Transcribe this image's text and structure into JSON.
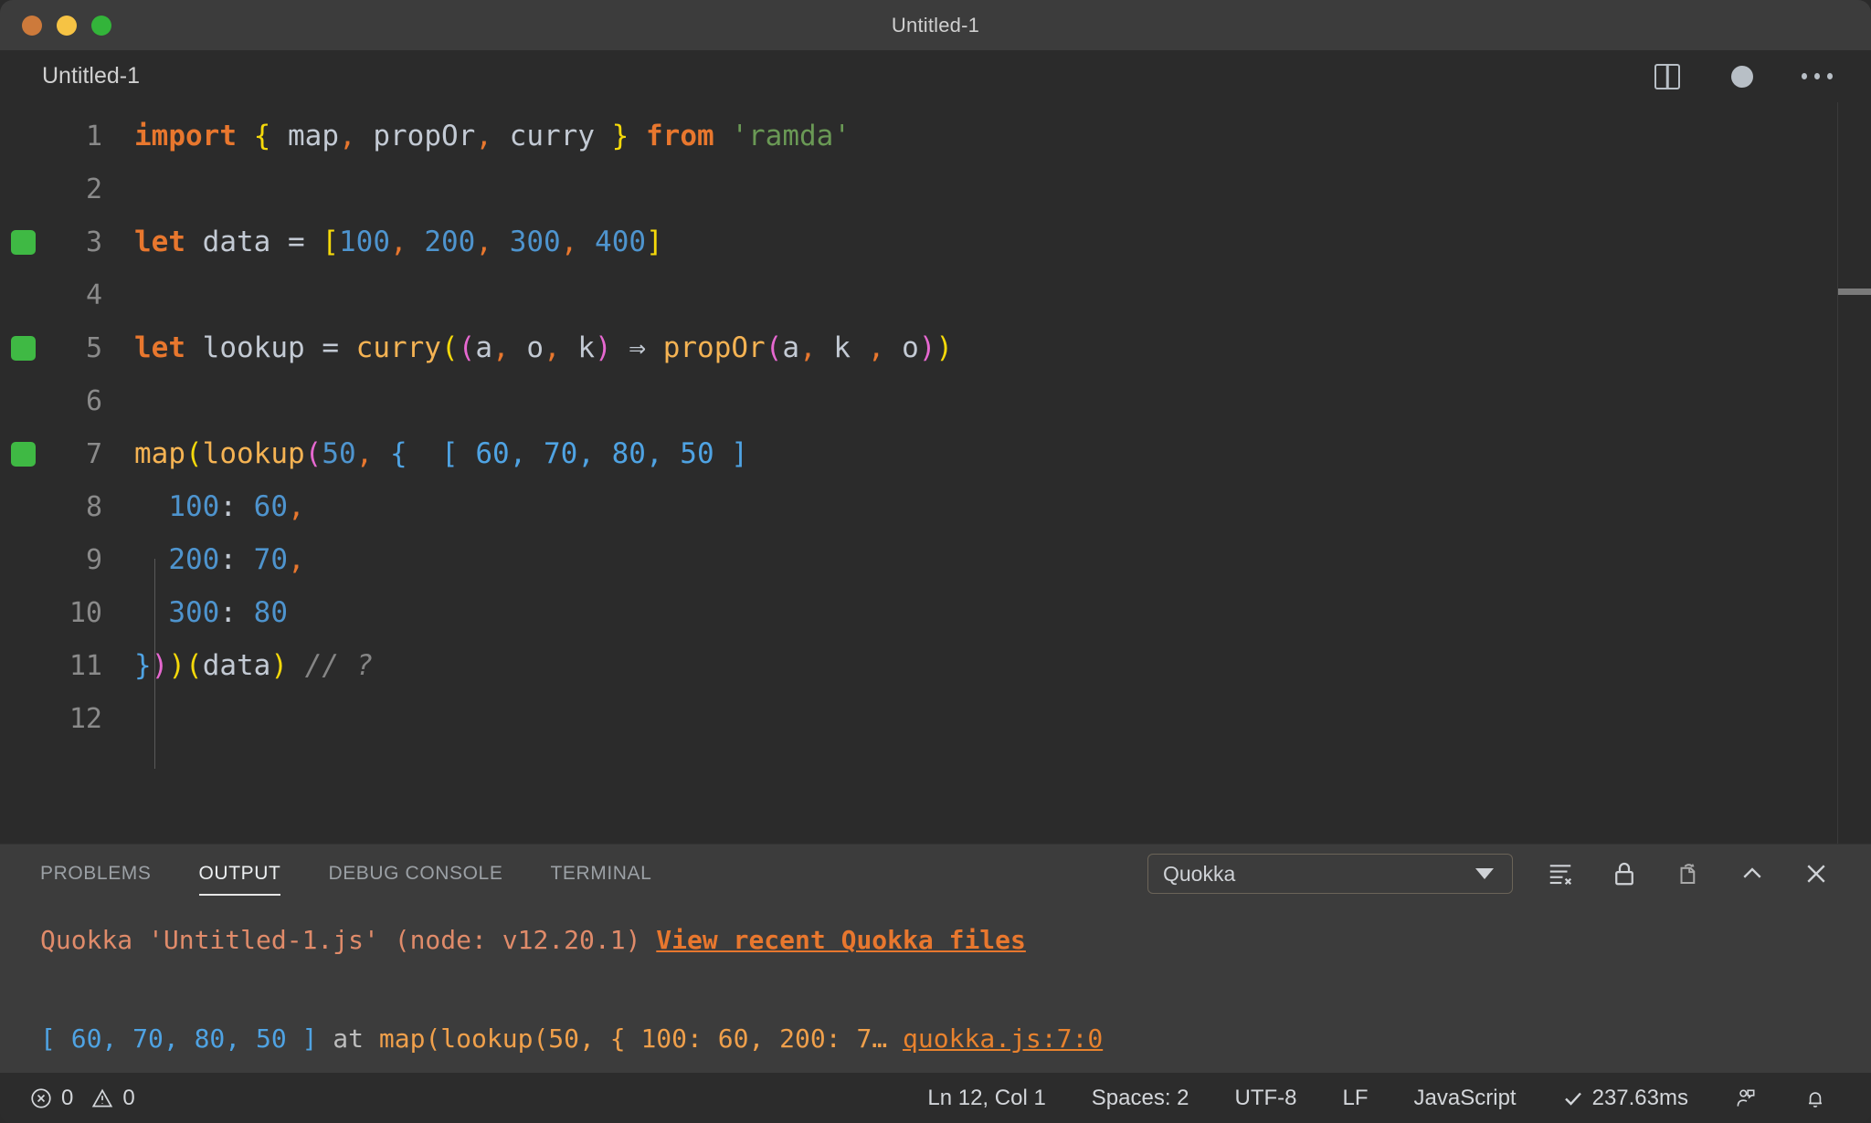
{
  "window": {
    "title": "Untitled-1",
    "traffic_lights": [
      "close-button",
      "minimize-button",
      "maximize-button"
    ]
  },
  "tab_bar": {
    "tabs": [
      {
        "label": "Untitled-1",
        "active": true,
        "dirty": true
      }
    ],
    "actions": [
      {
        "icon": "split-editor-icon",
        "label": "Split Editor"
      },
      {
        "icon": "unsaved-dot-icon",
        "label": "Unsaved changes"
      },
      {
        "icon": "more-actions-icon",
        "label": "More Actions..."
      }
    ]
  },
  "editor": {
    "language": "JavaScript",
    "lines": [
      {
        "num": "1",
        "marker": false,
        "tokens": [
          {
            "t": "import",
            "c": "kw"
          },
          {
            "t": " ",
            "c": "op"
          },
          {
            "t": "{",
            "c": "b-yel"
          },
          {
            "t": " ",
            "c": "op"
          },
          {
            "t": "map",
            "c": "var"
          },
          {
            "t": ",",
            "c": "punct"
          },
          {
            "t": " ",
            "c": "op"
          },
          {
            "t": "propOr",
            "c": "var"
          },
          {
            "t": ",",
            "c": "punct"
          },
          {
            "t": " ",
            "c": "op"
          },
          {
            "t": "curry",
            "c": "var"
          },
          {
            "t": " ",
            "c": "op"
          },
          {
            "t": "}",
            "c": "b-yel"
          },
          {
            "t": " ",
            "c": "op"
          },
          {
            "t": "from",
            "c": "kw"
          },
          {
            "t": " ",
            "c": "op"
          },
          {
            "t": "'ramda'",
            "c": "str"
          }
        ]
      },
      {
        "num": "2",
        "marker": false,
        "tokens": []
      },
      {
        "num": "3",
        "marker": true,
        "tokens": [
          {
            "t": "let",
            "c": "kw"
          },
          {
            "t": " ",
            "c": "op"
          },
          {
            "t": "data",
            "c": "var"
          },
          {
            "t": " = ",
            "c": "op"
          },
          {
            "t": "[",
            "c": "b-yel"
          },
          {
            "t": "100",
            "c": "num"
          },
          {
            "t": ",",
            "c": "punct"
          },
          {
            "t": " ",
            "c": "op"
          },
          {
            "t": "200",
            "c": "num"
          },
          {
            "t": ",",
            "c": "punct"
          },
          {
            "t": " ",
            "c": "op"
          },
          {
            "t": "300",
            "c": "num"
          },
          {
            "t": ",",
            "c": "punct"
          },
          {
            "t": " ",
            "c": "op"
          },
          {
            "t": "400",
            "c": "num"
          },
          {
            "t": "]",
            "c": "b-yel"
          }
        ]
      },
      {
        "num": "4",
        "marker": false,
        "tokens": []
      },
      {
        "num": "5",
        "marker": true,
        "tokens": [
          {
            "t": "let",
            "c": "kw"
          },
          {
            "t": " ",
            "c": "op"
          },
          {
            "t": "lookup",
            "c": "var"
          },
          {
            "t": " = ",
            "c": "op"
          },
          {
            "t": "curry",
            "c": "fn"
          },
          {
            "t": "(",
            "c": "b-yel"
          },
          {
            "t": "(",
            "c": "b-mag"
          },
          {
            "t": "a",
            "c": "var"
          },
          {
            "t": ",",
            "c": "punct"
          },
          {
            "t": " ",
            "c": "op"
          },
          {
            "t": "o",
            "c": "var"
          },
          {
            "t": ",",
            "c": "punct"
          },
          {
            "t": " ",
            "c": "op"
          },
          {
            "t": "k",
            "c": "var"
          },
          {
            "t": ")",
            "c": "b-mag"
          },
          {
            "t": " ",
            "c": "op"
          },
          {
            "t": "⇒",
            "c": "arrow"
          },
          {
            "t": " ",
            "c": "op"
          },
          {
            "t": "propOr",
            "c": "fn"
          },
          {
            "t": "(",
            "c": "b-mag"
          },
          {
            "t": "a",
            "c": "var"
          },
          {
            "t": ",",
            "c": "punct"
          },
          {
            "t": " ",
            "c": "op"
          },
          {
            "t": "k",
            "c": "var"
          },
          {
            "t": " ",
            "c": "op"
          },
          {
            "t": ",",
            "c": "punct"
          },
          {
            "t": " ",
            "c": "op"
          },
          {
            "t": "o",
            "c": "var"
          },
          {
            "t": ")",
            "c": "b-mag"
          },
          {
            "t": ")",
            "c": "b-yel"
          }
        ]
      },
      {
        "num": "6",
        "marker": false,
        "tokens": []
      },
      {
        "num": "7",
        "marker": true,
        "tokens": [
          {
            "t": "map",
            "c": "fn"
          },
          {
            "t": "(",
            "c": "b-yel"
          },
          {
            "t": "lookup",
            "c": "fn"
          },
          {
            "t": "(",
            "c": "b-mag"
          },
          {
            "t": "50",
            "c": "num"
          },
          {
            "t": ",",
            "c": "punct"
          },
          {
            "t": " ",
            "c": "op"
          },
          {
            "t": "{",
            "c": "b-blu"
          },
          {
            "t": "  ",
            "c": "op"
          },
          {
            "t": "[ 60, 70, 80, 50 ]",
            "c": "quokka-val"
          }
        ]
      },
      {
        "num": "8",
        "marker": false,
        "tokens": [
          {
            "t": "  ",
            "c": "op"
          },
          {
            "t": "100",
            "c": "num"
          },
          {
            "t": ":",
            "c": "op"
          },
          {
            "t": " ",
            "c": "op"
          },
          {
            "t": "60",
            "c": "num"
          },
          {
            "t": ",",
            "c": "punct"
          }
        ]
      },
      {
        "num": "9",
        "marker": false,
        "tokens": [
          {
            "t": "  ",
            "c": "op"
          },
          {
            "t": "200",
            "c": "num"
          },
          {
            "t": ":",
            "c": "op"
          },
          {
            "t": " ",
            "c": "op"
          },
          {
            "t": "70",
            "c": "num"
          },
          {
            "t": ",",
            "c": "punct"
          }
        ]
      },
      {
        "num": "10",
        "marker": false,
        "tokens": [
          {
            "t": "  ",
            "c": "op"
          },
          {
            "t": "300",
            "c": "num"
          },
          {
            "t": ":",
            "c": "op"
          },
          {
            "t": " ",
            "c": "op"
          },
          {
            "t": "80",
            "c": "num"
          }
        ]
      },
      {
        "num": "11",
        "marker": false,
        "tokens": [
          {
            "t": "}",
            "c": "b-blu"
          },
          {
            "t": ")",
            "c": "b-mag"
          },
          {
            "t": ")",
            "c": "b-yel"
          },
          {
            "t": "(",
            "c": "b-yel"
          },
          {
            "t": "data",
            "c": "var"
          },
          {
            "t": ")",
            "c": "b-yel"
          },
          {
            "t": " ",
            "c": "op"
          },
          {
            "t": "// ?",
            "c": "cmt"
          }
        ]
      },
      {
        "num": "12",
        "marker": false,
        "tokens": []
      }
    ]
  },
  "panel": {
    "tabs": [
      {
        "label": "PROBLEMS",
        "active": false
      },
      {
        "label": "OUTPUT",
        "active": true
      },
      {
        "label": "DEBUG CONSOLE",
        "active": false
      },
      {
        "label": "TERMINAL",
        "active": false
      }
    ],
    "channel_select": {
      "value": "Quokka",
      "options": [
        "Quokka"
      ]
    },
    "actions": [
      {
        "icon": "clear-output-icon",
        "label": "Clear Output"
      },
      {
        "icon": "lock-icon",
        "label": "Turn Auto Scrolling Off"
      },
      {
        "icon": "open-in-editor-icon",
        "label": "Open Output in Editor"
      },
      {
        "icon": "chevron-up-icon",
        "label": "Maximize Panel Size"
      },
      {
        "icon": "close-icon",
        "label": "Close Panel"
      }
    ],
    "output_lines": [
      {
        "segments": [
          {
            "t": "Quokka 'Untitled-1.js' (node: v12.20.1) ",
            "c": "out-salmon"
          },
          {
            "t": "View recent Quokka files",
            "c": "out-link"
          }
        ]
      },
      {
        "segments": []
      },
      {
        "segments": [
          {
            "t": "[ 60, 70, 80, 50 ]",
            "c": "out-blue"
          },
          {
            "t": " at ",
            "c": "out-gray"
          },
          {
            "t": "map(lookup(50, { 100: 60, 200: 7…",
            "c": "out-orange"
          },
          {
            "t": " ",
            "c": "out-gray"
          },
          {
            "t": "quokka.js:7:0",
            "c": "out-link2"
          }
        ]
      }
    ]
  },
  "status_bar": {
    "left": [
      {
        "icon": "error-icon",
        "label": "0"
      },
      {
        "icon": "warning-icon",
        "label": "0"
      }
    ],
    "right": [
      {
        "icon": null,
        "label": "Ln 12, Col 1",
        "name": "cursor-position"
      },
      {
        "icon": null,
        "label": "Spaces: 2",
        "name": "indentation"
      },
      {
        "icon": null,
        "label": "UTF-8",
        "name": "encoding"
      },
      {
        "icon": null,
        "label": "LF",
        "name": "eol"
      },
      {
        "icon": null,
        "label": "JavaScript",
        "name": "language-mode"
      },
      {
        "icon": "check-icon",
        "label": "237.63ms",
        "name": "quokka-timing"
      },
      {
        "icon": "feedback-icon",
        "label": "",
        "name": "feedback"
      },
      {
        "icon": "bell-icon",
        "label": "",
        "name": "notifications"
      }
    ]
  },
  "colors": {
    "titlebar_bg": "#3c3c3c",
    "editor_bg": "#2b2b2b",
    "panel_bg": "#3c3c3c",
    "statusbar_bg": "#2c2c2c",
    "coverage_green": "#3fb944",
    "keyword_orange": "#e8772e",
    "number_blue": "#4e94ce",
    "string_green": "#6a9955",
    "function_yellow": "#f5b353",
    "bracket_yellow": "#f5d90a",
    "bracket_magenta": "#e668d0",
    "bracket_blue": "#4fa3e3"
  }
}
